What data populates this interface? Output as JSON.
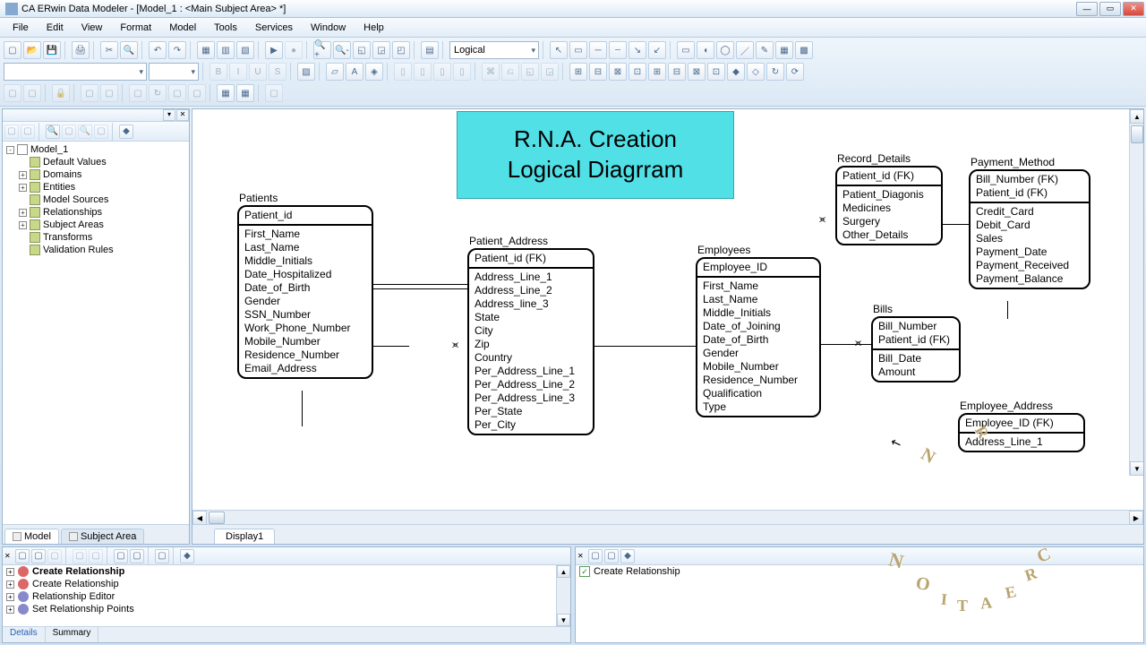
{
  "window_title": "CA ERwin Data Modeler - [Model_1 : <Main Subject Area> *]",
  "menus": [
    "File",
    "Edit",
    "View",
    "Format",
    "Model",
    "Tools",
    "Services",
    "Window",
    "Help"
  ],
  "view_combo": "Logical",
  "tree": {
    "root": "Model_1",
    "items": [
      "Default Values",
      "Domains",
      "Entities",
      "Model Sources",
      "Relationships",
      "Subject Areas",
      "Transforms",
      "Validation Rules"
    ]
  },
  "tree_tabs": {
    "model": "Model",
    "subject": "Subject Area"
  },
  "canvas_tab": "Display1",
  "diagram_title_line1": "R.N.A. Creation",
  "diagram_title_line2": "Logical Diagrram",
  "entities": {
    "patients": {
      "name": "Patients",
      "key": [
        "Patient_id"
      ],
      "attrs": [
        "First_Name",
        "Last_Name",
        "Middle_Initials",
        "Date_Hospitalized",
        "Date_of_Birth",
        "Gender",
        "SSN_Number",
        "Work_Phone_Number",
        "Mobile_Number",
        "Residence_Number",
        "Email_Address"
      ]
    },
    "patient_address": {
      "name": "Patient_Address",
      "key": [
        "Patient_id (FK)"
      ],
      "attrs": [
        "Address_Line_1",
        "Address_Line_2",
        "Address_line_3",
        "State",
        "City",
        "Zip",
        "Country",
        "Per_Address_Line_1",
        "Per_Address_Line_2",
        "Per_Address_Line_3",
        "Per_State",
        "Per_City"
      ]
    },
    "employees": {
      "name": "Employees",
      "key": [
        "Employee_ID"
      ],
      "attrs": [
        "First_Name",
        "Last_Name",
        "Middle_Initials",
        "Date_of_Joining",
        "Date_of_Birth",
        "Gender",
        "Mobile_Number",
        "Residence_Number",
        "Qualification",
        "Type"
      ]
    },
    "record_details": {
      "name": "Record_Details",
      "key": [
        "Patient_id (FK)"
      ],
      "attrs": [
        "Patient_Diagonis",
        "Medicines",
        "Surgery",
        "Other_Details"
      ]
    },
    "payment_method": {
      "name": "Payment_Method",
      "key": [
        "Bill_Number (FK)",
        "Patient_id (FK)"
      ],
      "attrs": [
        "Credit_Card",
        "Debit_Card",
        "Sales",
        "Payment_Date",
        "Payment_Received",
        "Payment_Balance"
      ]
    },
    "bills": {
      "name": "Bills",
      "key": [
        "Bill_Number",
        "Patient_id (FK)"
      ],
      "attrs": [
        "Bill_Date",
        "Amount"
      ]
    },
    "employee_address": {
      "name": "Employee_Address",
      "key": [
        "Employee_ID (FK)"
      ],
      "attrs": [
        "Address_Line_1"
      ]
    }
  },
  "action_panel": {
    "items": [
      "Create Relationship",
      "Create Relationship",
      "Relationship Editor",
      "Set Relationship Points"
    ],
    "tabs": [
      "Details",
      "Summary"
    ]
  },
  "advisor_panel": {
    "item": "Create Relationship"
  }
}
